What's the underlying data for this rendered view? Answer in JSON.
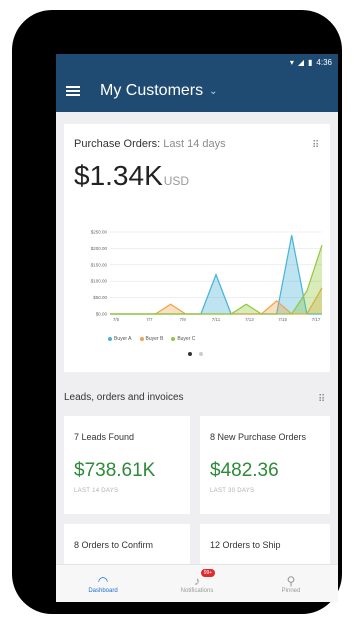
{
  "statusbar": {
    "time": "4:36"
  },
  "appbar": {
    "title": "My Customers"
  },
  "purchase_orders": {
    "title": "Purchase Orders:",
    "subtitle": "Last 14 days",
    "amount": "$1.34K",
    "currency": "USD",
    "legend": [
      "Buyer A",
      "Buyer B",
      "Buyer C"
    ],
    "colors": {
      "a": "#45b3d9",
      "b": "#f2a24a",
      "c": "#8fc93a"
    }
  },
  "chart_data": {
    "type": "area",
    "categories": [
      "7/5",
      "7/7",
      "7/9",
      "7/11",
      "7/13",
      "7/15",
      "7/17"
    ],
    "yticks": [
      "$0.00",
      "$50.00",
      "$100.00",
      "$150.00",
      "$200.00",
      "$250.00"
    ],
    "ylim": [
      0,
      250
    ],
    "series": [
      {
        "name": "Buyer A",
        "values": [
          0,
          0,
          0,
          0,
          0,
          0,
          0,
          120,
          0,
          0,
          0,
          0,
          240,
          0,
          0
        ]
      },
      {
        "name": "Buyer B",
        "values": [
          0,
          0,
          0,
          0,
          30,
          0,
          0,
          0,
          0,
          0,
          0,
          40,
          0,
          0,
          80
        ]
      },
      {
        "name": "Buyer C",
        "values": [
          0,
          0,
          0,
          0,
          0,
          0,
          0,
          0,
          0,
          30,
          0,
          0,
          0,
          70,
          210
        ]
      }
    ]
  },
  "section": {
    "title": "Leads, orders and invoices"
  },
  "tiles": [
    {
      "label": "7 Leads Found",
      "value": "$738.61K",
      "caption": "LAST 14 DAYS"
    },
    {
      "label": "8 New Purchase Orders",
      "value": "$482.36",
      "caption": "LAST 30 DAYS"
    },
    {
      "label": "8 Orders to Confirm"
    },
    {
      "label": "12 Orders to Ship"
    }
  ],
  "nav": [
    {
      "label": "Dashboard",
      "icon": "gauge-icon"
    },
    {
      "label": "Notifications",
      "icon": "bell-icon",
      "badge": "99+"
    },
    {
      "label": "Pinned",
      "icon": "pin-icon"
    }
  ]
}
